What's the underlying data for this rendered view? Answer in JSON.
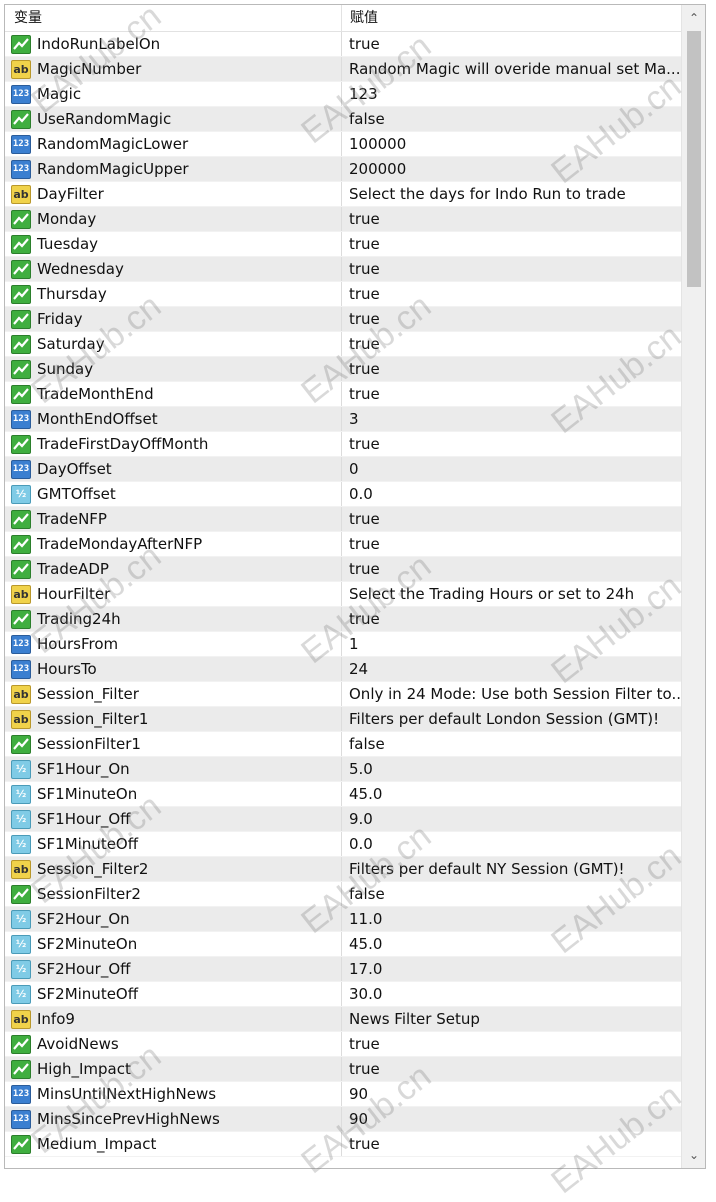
{
  "header": {
    "name_col": "变量",
    "value_col": "赋值"
  },
  "rows": [
    {
      "type": "bool",
      "name": "IndoRunLabelOn",
      "value": "true"
    },
    {
      "type": "string",
      "name": "MagicNumber",
      "value": "Random Magic will overide manual set Ma..."
    },
    {
      "type": "int",
      "name": "Magic",
      "value": "123"
    },
    {
      "type": "bool",
      "name": "UseRandomMagic",
      "value": "false"
    },
    {
      "type": "int",
      "name": "RandomMagicLower",
      "value": "100000"
    },
    {
      "type": "int",
      "name": "RandomMagicUpper",
      "value": "200000"
    },
    {
      "type": "string",
      "name": "DayFilter",
      "value": "Select the days for Indo Run to trade"
    },
    {
      "type": "bool",
      "name": "Monday",
      "value": "true"
    },
    {
      "type": "bool",
      "name": "Tuesday",
      "value": "true"
    },
    {
      "type": "bool",
      "name": "Wednesday",
      "value": "true"
    },
    {
      "type": "bool",
      "name": "Thursday",
      "value": "true"
    },
    {
      "type": "bool",
      "name": "Friday",
      "value": "true"
    },
    {
      "type": "bool",
      "name": "Saturday",
      "value": "true"
    },
    {
      "type": "bool",
      "name": "Sunday",
      "value": "true"
    },
    {
      "type": "bool",
      "name": "TradeMonthEnd",
      "value": "true"
    },
    {
      "type": "int",
      "name": "MonthEndOffset",
      "value": "3"
    },
    {
      "type": "bool",
      "name": "TradeFirstDayOffMonth",
      "value": "true"
    },
    {
      "type": "int",
      "name": "DayOffset",
      "value": "0"
    },
    {
      "type": "double",
      "name": "GMTOffset",
      "value": "0.0"
    },
    {
      "type": "bool",
      "name": "TradeNFP",
      "value": "true"
    },
    {
      "type": "bool",
      "name": "TradeMondayAfterNFP",
      "value": "true"
    },
    {
      "type": "bool",
      "name": "TradeADP",
      "value": "true"
    },
    {
      "type": "string",
      "name": "HourFilter",
      "value": "Select the Trading Hours or set to 24h"
    },
    {
      "type": "bool",
      "name": "Trading24h",
      "value": "true"
    },
    {
      "type": "int",
      "name": "HoursFrom",
      "value": "1"
    },
    {
      "type": "int",
      "name": "HoursTo",
      "value": "24"
    },
    {
      "type": "string",
      "name": "Session_Filter",
      "value": "Only in 24 Mode: Use both Session Filter to..."
    },
    {
      "type": "string",
      "name": "Session_Filter1",
      "value": "Filters per default London Session (GMT)!"
    },
    {
      "type": "bool",
      "name": "SessionFilter1",
      "value": "false"
    },
    {
      "type": "double",
      "name": "SF1Hour_On",
      "value": "5.0"
    },
    {
      "type": "double",
      "name": "SF1MinuteOn",
      "value": "45.0"
    },
    {
      "type": "double",
      "name": "SF1Hour_Off",
      "value": "9.0"
    },
    {
      "type": "double",
      "name": "SF1MinuteOff",
      "value": "0.0"
    },
    {
      "type": "string",
      "name": "Session_Filter2",
      "value": "Filters per default NY Session (GMT)!"
    },
    {
      "type": "bool",
      "name": "SessionFilter2",
      "value": "false"
    },
    {
      "type": "double",
      "name": "SF2Hour_On",
      "value": "11.0"
    },
    {
      "type": "double",
      "name": "SF2MinuteOn",
      "value": "45.0"
    },
    {
      "type": "double",
      "name": "SF2Hour_Off",
      "value": "17.0"
    },
    {
      "type": "double",
      "name": "SF2MinuteOff",
      "value": "30.0"
    },
    {
      "type": "string",
      "name": "Info9",
      "value": "News Filter Setup"
    },
    {
      "type": "bool",
      "name": "AvoidNews",
      "value": "true"
    },
    {
      "type": "bool",
      "name": "High_Impact",
      "value": "true"
    },
    {
      "type": "int",
      "name": "MinsUntilNextHighNews",
      "value": "90"
    },
    {
      "type": "int",
      "name": "MinsSincePrevHighNews",
      "value": "90"
    },
    {
      "type": "bool",
      "name": "Medium_Impact",
      "value": "true"
    }
  ],
  "icon_glyphs": {
    "string": "ab",
    "int": "123",
    "double": "½"
  },
  "scrollbar": {
    "up": "⌃",
    "down": "⌄"
  },
  "watermark": "EAHub.cn"
}
